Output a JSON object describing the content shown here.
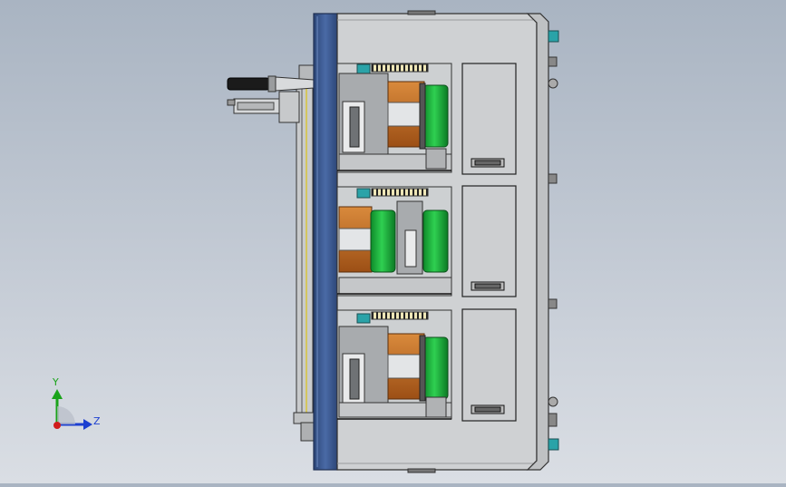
{
  "viewport": {
    "background_top": "#a9b4c2",
    "background_bottom": "#dadee4"
  },
  "triad": {
    "y_label": "Y",
    "z_label": "Z",
    "y_color": "#1aa31a",
    "z_color": "#1c3fd0",
    "origin_color": "#d01c1c"
  },
  "model": {
    "frame_color": "#cfd1d3",
    "side_panel_color": "#3f5c91",
    "roller_color": "#19b43a",
    "slide_color": "#c06a24",
    "valve_color": "#2aa3a8",
    "module_count": 3
  }
}
